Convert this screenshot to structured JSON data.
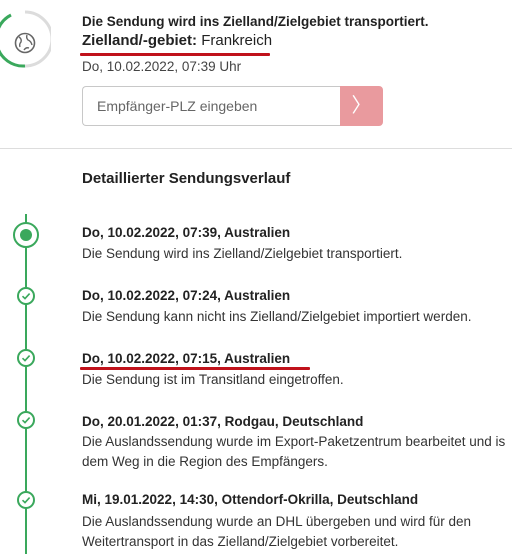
{
  "status": {
    "headline": "Die Sendung wird ins Zielland/Zielgebiet transportiert.",
    "destination_label": "Zielland/-gebiet:",
    "destination_value": "Frankreich",
    "timestamp": "Do, 10.02.2022, 07:39 Uhr",
    "icon": "globe-icon"
  },
  "plz": {
    "placeholder": "Empfänger-PLZ eingeben",
    "button_glyph": "〉"
  },
  "history": {
    "title": "Detaillierter Sendungsverlauf",
    "events": [
      {
        "head": "Do, 10.02.2022, 07:39, Australien",
        "text": "Die Sendung wird ins Zielland/Zielgebiet transportiert."
      },
      {
        "head": "Do, 10.02.2022, 07:24, Australien",
        "text": "Die Sendung kann nicht ins Zielland/Zielgebiet importiert werden."
      },
      {
        "head": "Do, 10.02.2022, 07:15, Australien",
        "text": "Die Sendung ist im Transitland eingetroffen."
      },
      {
        "head": "Do, 20.01.2022, 01:37, Rodgau, Deutschland",
        "text": "Die Auslandssendung wurde im Export-Paketzentrum bearbeitet und is dem Weg in die Region des Empfängers."
      },
      {
        "head": "Mi, 19.01.2022, 14:30, Ottendorf-Okrilla, Deutschland",
        "text": "Die Auslandssendung wurde an DHL übergeben und wird für den Weitertransport in das Zielland/Zielgebiet vorbereitet."
      }
    ]
  },
  "colors": {
    "accent_green": "#3aa85c",
    "underline_red": "#c0121b",
    "button_pink": "#e99a9e"
  }
}
